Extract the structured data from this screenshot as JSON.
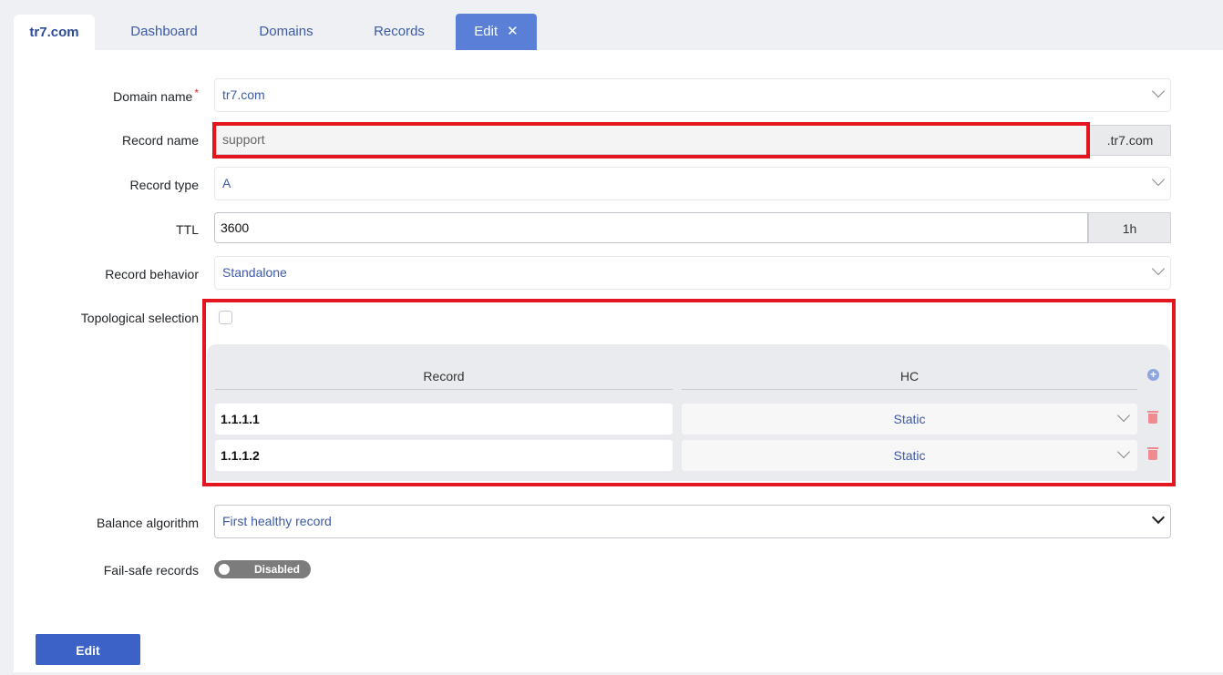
{
  "tabs": {
    "brand": "tr7.com",
    "dashboard": "Dashboard",
    "domains": "Domains",
    "records": "Records",
    "edit": "Edit",
    "close_glyph": "✕"
  },
  "form": {
    "domain_name": {
      "label": "Domain name",
      "required_mark": "*",
      "value": "tr7.com"
    },
    "record_name": {
      "label": "Record name",
      "value": "support",
      "suffix": ".tr7.com"
    },
    "record_type": {
      "label": "Record type",
      "value": "A"
    },
    "ttl": {
      "label": "TTL",
      "value": "3600",
      "addon": "1h"
    },
    "record_behavior": {
      "label": "Record behavior",
      "value": "Standalone"
    },
    "topological_selection": {
      "label": "Topological selection",
      "checked": false
    },
    "balance_algorithm": {
      "label": "Balance algorithm",
      "value": "First healthy record"
    },
    "fail_safe": {
      "label": "Fail-safe records",
      "state": "Disabled"
    }
  },
  "records_table": {
    "headers": {
      "record": "Record",
      "hc": "HC"
    },
    "rows": [
      {
        "record": "1.1.1.1",
        "hc": "Static"
      },
      {
        "record": "1.1.1.2",
        "hc": "Static"
      }
    ]
  },
  "actions": {
    "submit": "Edit"
  },
  "colors": {
    "accent": "#3c62c8",
    "highlight": "#e3161f",
    "link": "#3c5aa8"
  }
}
